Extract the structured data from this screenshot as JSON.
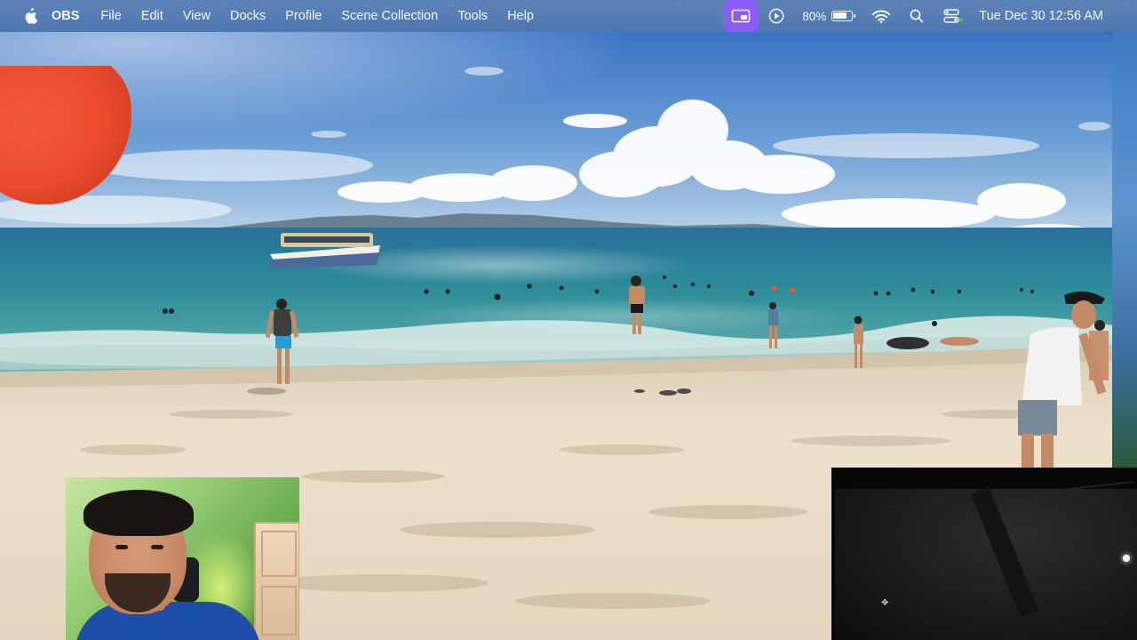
{
  "menubar": {
    "app_name": "OBS",
    "menus": [
      "File",
      "Edit",
      "View",
      "Docks",
      "Profile",
      "Scene Collection",
      "Tools",
      "Help"
    ],
    "status": {
      "screen_share_icon": "screen-share-icon",
      "play_icon": "play-circle-icon",
      "battery_percent": "80%",
      "battery_level": 0.8,
      "wifi_icon": "wifi-icon",
      "search_icon": "search-icon",
      "control_center_icon": "control-center-icon",
      "clock": "Tue Dec 30  12:56 AM"
    },
    "accent": "#8b5cf6"
  },
  "preview": {
    "main_source": "beach-video",
    "overlays": [
      "red-widget",
      "webcam",
      "dark-window"
    ]
  },
  "colors": {
    "sky_top": "#3f78c8",
    "sea": "#2f8f98",
    "sand": "#e8dcc6",
    "webcam_bg": "#9ed27c",
    "shirt": "#1e4fa8"
  }
}
